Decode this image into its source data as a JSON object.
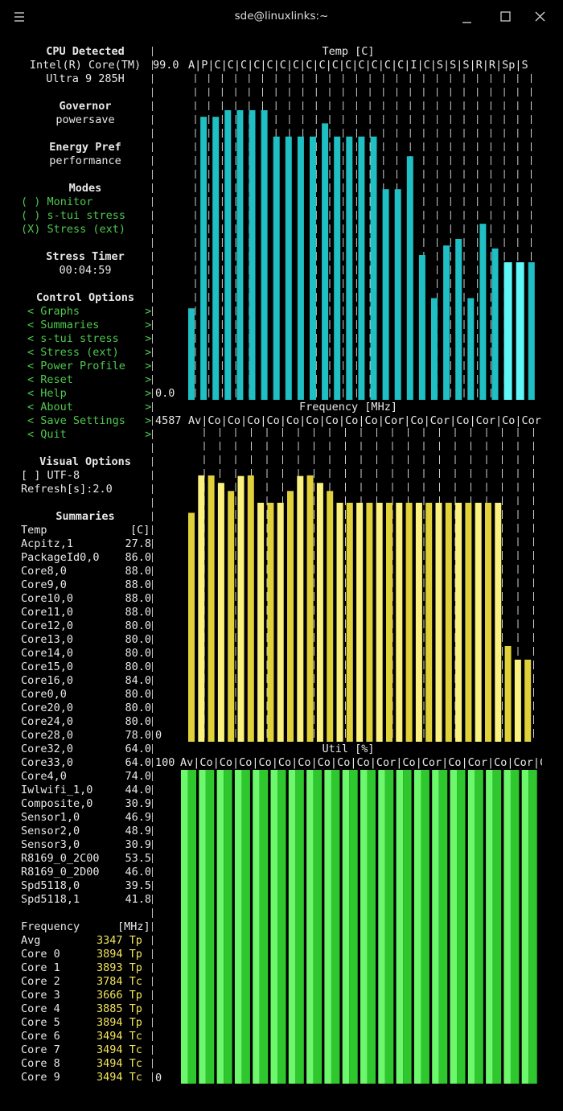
{
  "window": {
    "title": "sde@linuxlinks:~"
  },
  "sidebar": {
    "cpu_heading": "CPU Detected",
    "cpu_line1": "Intel(R) Core(TM)",
    "cpu_line2": "Ultra 9 285H",
    "governor_heading": "Governor",
    "governor_value": "powersave",
    "energy_heading": "Energy Pref",
    "energy_value": "performance",
    "modes_heading": "Modes",
    "modes": [
      "( ) Monitor",
      "( ) s-tui stress",
      "(X) Stress (ext)"
    ],
    "stress_timer_heading": "Stress Timer",
    "stress_timer_value": "00:04:59",
    "control_heading": "Control Options",
    "controls": [
      "< Graphs          >",
      "< Summaries       >",
      "< s-tui stress    >",
      "< Stress (ext)    >",
      "< Power Profile   >",
      "< Reset           >",
      "< Help            >",
      "< About           >",
      "< Save Settings   >",
      "< Quit            >"
    ],
    "visual_heading": "Visual Options",
    "visual_utf8": "[ ] UTF-8",
    "refresh": "Refresh[s]:2.0",
    "summaries_heading": "Summaries",
    "temp_header": {
      "label": "Temp",
      "unit": "[C]"
    },
    "temps": [
      [
        "Acpitz,1",
        "27.8"
      ],
      [
        "PackageId0,0",
        "86.0"
      ],
      [
        "Core8,0",
        "88.0"
      ],
      [
        "Core9,0",
        "88.0"
      ],
      [
        "Core10,0",
        "88.0"
      ],
      [
        "Core11,0",
        "88.0"
      ],
      [
        "Core12,0",
        "80.0"
      ],
      [
        "Core13,0",
        "80.0"
      ],
      [
        "Core14,0",
        "80.0"
      ],
      [
        "Core15,0",
        "80.0"
      ],
      [
        "Core16,0",
        "84.0"
      ],
      [
        "Core0,0",
        "80.0"
      ],
      [
        "Core20,0",
        "80.0"
      ],
      [
        "Core24,0",
        "80.0"
      ],
      [
        "Core28,0",
        "78.0"
      ],
      [
        "Core32,0",
        "64.0"
      ],
      [
        "Core33,0",
        "64.0"
      ],
      [
        "Core4,0",
        "74.0"
      ],
      [
        "Iwlwifi_1,0",
        "44.0"
      ],
      [
        "Composite,0",
        "30.9"
      ],
      [
        "Sensor1,0",
        "46.9"
      ],
      [
        "Sensor2,0",
        "48.9"
      ],
      [
        "Sensor3,0",
        "30.9"
      ],
      [
        "R8169_0_2C00",
        "53.5"
      ],
      [
        "R8169_0_2D00",
        "46.0"
      ],
      [
        "Spd5118,0",
        "39.5"
      ],
      [
        "Spd5118,1",
        "41.8"
      ]
    ],
    "freq_header": {
      "label": "Frequency",
      "unit": "[MHz]"
    },
    "freqs": [
      [
        "Avg",
        "3347",
        "Tp"
      ],
      [
        "Core 0",
        "3894",
        "Tp"
      ],
      [
        "Core 1",
        "3893",
        "Tp"
      ],
      [
        "Core 2",
        "3784",
        "Tc"
      ],
      [
        "Core 3",
        "3666",
        "Tp"
      ],
      [
        "Core 4",
        "3885",
        "Tp"
      ],
      [
        "Core 5",
        "3894",
        "Tp"
      ],
      [
        "Core 6",
        "3494",
        "Tc"
      ],
      [
        "Core 7",
        "3494",
        "Tc"
      ],
      [
        "Core 8",
        "3494",
        "Tc"
      ],
      [
        "Core 9",
        "3494",
        "Tc"
      ]
    ]
  },
  "temp_graph": {
    "title": "Temp [C]",
    "max_label": "99.0",
    "min_label": "0.0",
    "labels_line": "A|P|C|C|C|C|C|C|C|C|C|C|C|C|C|C|C|I|C|S|S|S|R|R|Sp|S",
    "color": "#1fbfc4",
    "highlight_color": "#5ff6f8",
    "max": 99,
    "values": [
      27.8,
      86.0,
      86.0,
      88.0,
      88.0,
      88.0,
      88.0,
      80.0,
      80.0,
      80.0,
      80.0,
      84.0,
      80.0,
      80.0,
      80.0,
      80.0,
      64.0,
      64.0,
      74.0,
      44.0,
      30.9,
      46.9,
      48.9,
      30.9,
      53.5,
      46.0,
      41.8,
      41.8,
      41.8
    ]
  },
  "freq_graph": {
    "title": "Frequency [MHz]",
    "max_label": "4587",
    "min_label": "0",
    "labels_line": "Av|Co|Co|Co|Co|Co|Co|Co|Co|Co|Cor|Co|Cor|Co|Cor|Co|Cor|Co|Cor|Co|Cor|Co",
    "colors": [
      "#e0d03a",
      "#fbf17e"
    ],
    "max": 4587,
    "values": [
      3347,
      3894,
      3893,
      3784,
      3666,
      3885,
      3894,
      3494,
      3494,
      3494,
      3666,
      3885,
      3894,
      3784,
      3666,
      3494,
      3494,
      3494,
      3494,
      3494,
      3494,
      3494,
      3494,
      3494,
      3494,
      3494,
      3494,
      3494,
      3494,
      3494,
      3494,
      3494,
      1400,
      1200,
      1200
    ]
  },
  "util_graph": {
    "title": "Util [%]",
    "max_label": "100",
    "min_label": "0",
    "labels_line": "Av|Co|Co|Co|Co|Co|Co|Co|Co|Co|Cor|Co|Cor|Co|Cor|Co|Cor|Co|Cor|Co|Cor|Co",
    "colors": [
      "#2ec82e",
      "#6cf76c"
    ],
    "max": 100,
    "values": [
      100,
      100,
      100,
      100,
      100,
      100,
      100,
      100,
      100,
      100,
      100,
      100,
      100,
      100,
      100,
      100,
      100,
      100,
      100,
      100
    ]
  }
}
